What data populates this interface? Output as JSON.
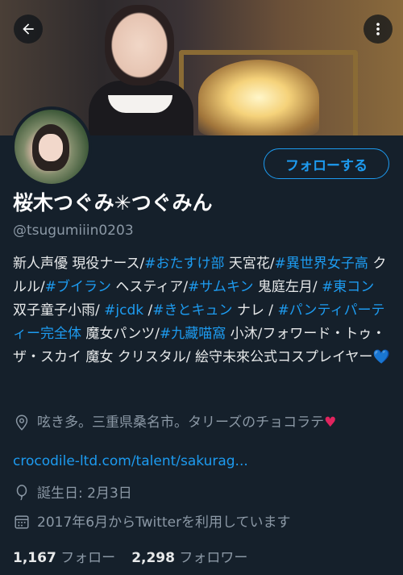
{
  "profile": {
    "name": "桜木つぐみ✳︎つぐみん",
    "handle": "@tsugumiiin0203",
    "follow_button": "フォローする",
    "bio": {
      "t1": "新人声優 現役ナース/",
      "h1": "#おたすけ部",
      "t2": " 天宮花/",
      "h2": "#異世界女子高",
      "t3": " クルル/",
      "h3": "#ブイラン",
      "t4": " ヘスティア/",
      "h4": "#サムキン",
      "t5": " 鬼庭左月/ ",
      "h5": "#東コン",
      "t6": " 双子童子小雨/ ",
      "h6": "#jcdk",
      "t7": " /",
      "h7": "#きとキュン",
      "t8": " ナレ / ",
      "h8": "#パンティパーティー完全体",
      "t9": " 魔女パンツ/",
      "h9": "#九藏喵窩",
      "t10": " 小沐/フォワード・トゥ・ザ・スカイ 魔女 クリスタル/ 絵守未來公式コスプレイヤー",
      "heart": "💙"
    },
    "location": {
      "text": "呟き多。三重県桑名市。タリーズのチョコラテ",
      "heart": "♥"
    },
    "url": "crocodile-ltd.com/talent/sakurag...",
    "birthday": "誕生日: 2月3日",
    "joined": "2017年6月からTwitterを利用しています",
    "following_count": "1,167",
    "following_label": "フォロー",
    "followers_count": "2,298",
    "followers_label": "フォロワー"
  },
  "icons": [
    "back-arrow-icon",
    "more-vertical-icon",
    "location-pin-icon",
    "birthday-balloon-icon",
    "calendar-icon"
  ],
  "colors": {
    "background": "#15202b",
    "accent": "#1d9bf0",
    "secondary_text": "#8b98a5"
  }
}
